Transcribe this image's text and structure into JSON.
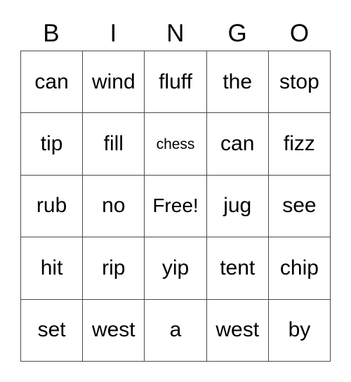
{
  "card": {
    "headers": [
      "B",
      "I",
      "N",
      "G",
      "O"
    ],
    "rows": [
      [
        {
          "text": "can",
          "size": "normal"
        },
        {
          "text": "wind",
          "size": "normal"
        },
        {
          "text": "fluff",
          "size": "normal"
        },
        {
          "text": "the",
          "size": "normal"
        },
        {
          "text": "stop",
          "size": "normal"
        }
      ],
      [
        {
          "text": "tip",
          "size": "normal"
        },
        {
          "text": "fill",
          "size": "normal"
        },
        {
          "text": "chess",
          "size": "shrink"
        },
        {
          "text": "can",
          "size": "normal"
        },
        {
          "text": "fizz",
          "size": "normal"
        }
      ],
      [
        {
          "text": "rub",
          "size": "normal"
        },
        {
          "text": "no",
          "size": "normal"
        },
        {
          "text": "Free!",
          "size": "tight"
        },
        {
          "text": "jug",
          "size": "normal"
        },
        {
          "text": "see",
          "size": "normal"
        }
      ],
      [
        {
          "text": "hit",
          "size": "normal"
        },
        {
          "text": "rip",
          "size": "normal"
        },
        {
          "text": "yip",
          "size": "normal"
        },
        {
          "text": "tent",
          "size": "normal"
        },
        {
          "text": "chip",
          "size": "normal"
        }
      ],
      [
        {
          "text": "set",
          "size": "normal"
        },
        {
          "text": "west",
          "size": "normal"
        },
        {
          "text": "a",
          "size": "normal"
        },
        {
          "text": "west",
          "size": "normal"
        },
        {
          "text": "by",
          "size": "normal"
        }
      ]
    ]
  },
  "colors": {
    "background": "#ffffff",
    "text": "#000000",
    "border": "#4a4a4a"
  }
}
